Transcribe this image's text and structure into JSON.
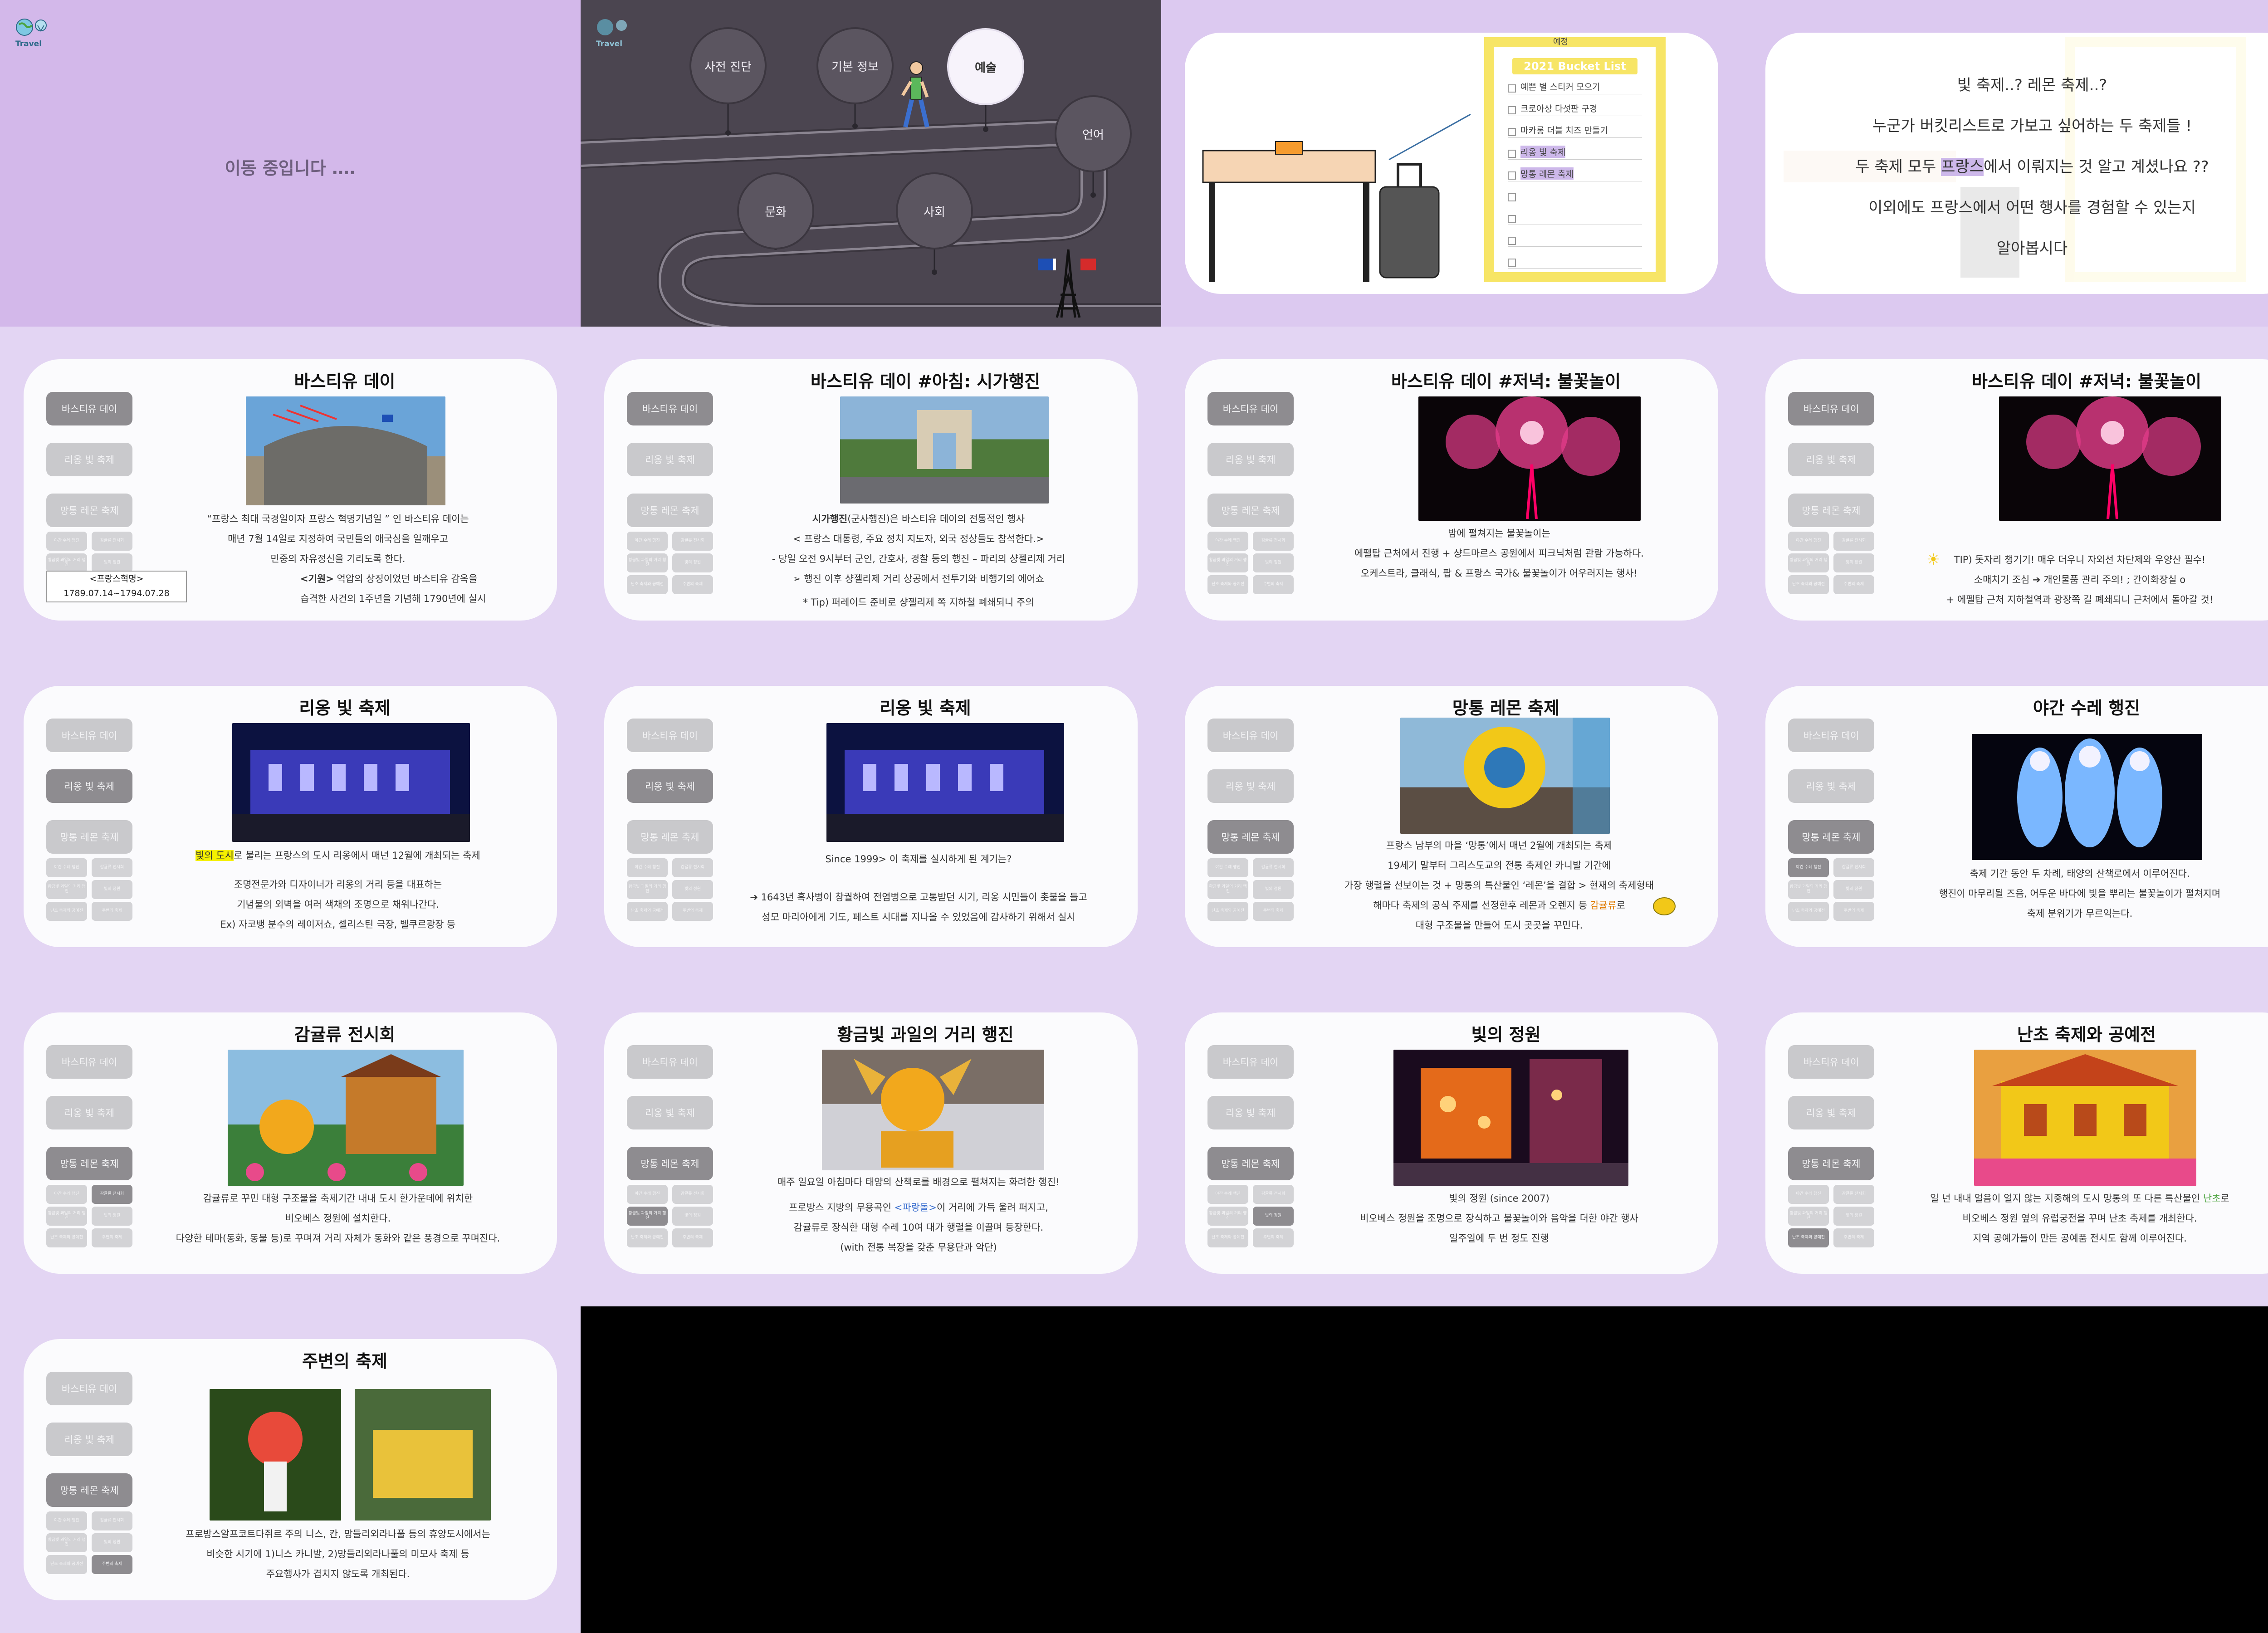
{
  "colors": {
    "lavender": "#d3b8ea",
    "map_bg": "#4b4550",
    "slide_bg": "#e3d5f3",
    "side_on": "#8e8c90",
    "side_off": "#c9c9cc"
  },
  "intro": {
    "logo_text": "Travel",
    "moving_text": "이동 중입니다 ….",
    "map_nodes": [
      "사전 진단",
      "기본 정보",
      "예술",
      "언어",
      "문화",
      "사회"
    ],
    "bucket_tag": "예정",
    "bucket_title": "2021 Bucket List",
    "bucket_items": [
      "예쁜 별 스티커 모으기",
      "크로아상 다섯판 구경",
      "마카롱 더블 치즈 만들기",
      "리옹 빛 축제",
      "망통 레몬 축제",
      "",
      "",
      "",
      ""
    ],
    "question_lines": [
      "빛 축제..? 레몬 축제..?",
      "누군가 버킷리스트로 가보고 싶어하는 두 축제들 !",
      "두 축제 모두 ",
      "프랑스",
      "에서 이뤄지는 것 알고 계셨나요 ??",
      "이외에도 프랑스에서 어떤 행사를 경험할 수 있는지",
      "알아봅시다"
    ]
  },
  "sidebar": {
    "main": [
      "바스티유 데이",
      "리옹 빛 축제",
      "망통 레몬 축제"
    ],
    "sub": [
      "야간 수레 행진",
      "감귤류 전시회",
      "황금빛 과일의 거리 행진",
      "빛의 정원",
      "난초 축제와 공예전",
      "주변의 축제"
    ]
  },
  "slides": [
    {
      "title": "바스티유 데이",
      "lines": [
        "“프랑스 최대 국경일이자 프랑스 혁명기념일 ” 인 바스티유 데이는",
        "매년 7월 14일로 지정하여 국민들의 애국심을 일깨우고",
        "민중의 자유정신을 기리도록 한다."
      ],
      "box_title": "<프랑스혁명>",
      "box_dates": "1789.07.14~1794.07.28",
      "origin_label": "<기원>",
      "origin_lines": [
        " 억압의 상징이었던 바스티유 감옥을",
        "습격한 사건의 1주년을 기념해 1790년에 실시"
      ]
    },
    {
      "title": "바스티유 데이 #아침: 시가행진",
      "lead": "시가행진",
      "lines": [
        "(군사행진)은 바스티유 데이의 전통적인 행사",
        "< 프랑스 대통령, 주요 정치 지도자, 외국 정상들도 참석한다.>",
        "- 당일 오전 9시부터 군인, 간호사, 경찰 등의 행진 – 파리의 샹젤리제 거리",
        "➢  행진 이후 샹젤리제 거리 상공에서 전투기와 비행기의 에어쇼",
        "* Tip) 퍼레이드 준비로 샹젤리제 쪽 지하철 폐쇄되니 주의"
      ]
    },
    {
      "title": "바스티유 데이 #저녁: 불꽃놀이",
      "lines": [
        "밤에 펼쳐지는 불꽃놀이는",
        "에펠탑 근처에서 진행 + 샹드마르스 공원에서 피크닉처럼 관람 가능하다.",
        "오케스트라, 클래식, 팝 & 프랑스 국가& 불꽃놀이가 어우러지는 행사!"
      ]
    },
    {
      "title": "바스티유 데이 #저녁: 불꽃놀이",
      "lines": [
        "TIP) 돗자리 챙기기! 매우 더우니 자외선 차단제와 우양산 필수!",
        "소매치기 조심 ➔ 개인물품 관리 주의! ; 간이화장실 o",
        "+ 에펠탑 근처 지하철역과 광장쪽 길 폐쇄되니 근처에서 돌아갈 것!"
      ]
    },
    {
      "title": "리옹 빛 축제",
      "hl": "빛의 도시",
      "lines": [
        "로 불리는 프랑스의 도시 리옹에서 매년 12월에 개최되는 축제",
        "조명전문가와 디자이너가 리옹의 거리 등을 대표하는",
        "기념물의 외벽을 여러 색채의 조명으로 채워나간다.",
        "Ex) 자코뱅 분수의 레이저쇼, 셀리스틴 극장, 벨쿠르광장 등"
      ]
    },
    {
      "title": "리옹 빛 축제",
      "lines": [
        "Since 1999> 이 축제를 실시하게 된 계기는?",
        "➔ 1643년 흑사병이 창궐하여 전염병으로 고통받던 시기, 리옹 시민들이 촛불을 들고",
        "성모 마리아에게 기도, 페스트 시대를 지나올 수 있었음에 감사하기 위해서 실시"
      ]
    },
    {
      "title": "망통 레몬 축제",
      "lines": [
        "프랑스 남부의 마을 ‘망통’에서 매년 2월에 개최되는 축제",
        "19세기 말부터 그리스도교의 전통 축제인 카니발 기간에",
        "가장 행렬을 선보이는 것 + 망통의 특산물인 ‘레몬’을 결합 > 현재의 축제형태",
        "해마다 축제의 공식 주제를 선정한후 레몬과 오렌지 등 ",
        "감귤류",
        "로",
        "대형 구조물을 만들어 도시 곳곳을 꾸민다."
      ]
    },
    {
      "title": "야간 수레 행진",
      "lines": [
        "축제 기간 동안 두 차례, 태양의 산책로에서 이루어진다.",
        "행진이 마무리될 즈음, 어두운 바다에 빛을 뿌리는 불꽃놀이가 펼쳐지며",
        "축제 분위기가 무르익는다."
      ]
    },
    {
      "title": "감귤류 전시회",
      "lines": [
        "감귤류로 꾸민 대형 구조물을 축제기간 내내 도시 한가운데에 위치한",
        "비오베스 정원에 설치한다.",
        "다양한 테마(동화, 동물 등)로 꾸며져 거리 자체가 동화와 같은 풍경으로 꾸며진다."
      ]
    },
    {
      "title": "황금빛 과일의 거리 행진",
      "lines": [
        "매주 일요일 아침마다 태양의 산책로를 배경으로 펼쳐지는 화려한 행진!",
        "프로방스 지방의 무용곡인 ",
        "<파랑돌>",
        "이 거리에 가득 울려 퍼지고,",
        "감귤류로 장식한 대형 수레 10여 대가 행렬을 이끌며 등장한다.",
        "(with 전통 복장을 갖춘 무용단과 악단)"
      ]
    },
    {
      "title": "빛의 정원",
      "lines": [
        "빛의 정원 (since 2007)",
        "비오베스 정원을 조명으로 장식하고 불꽃놀이와 음악을 더한 야간 행사",
        "일주일에 두 번 정도 진행"
      ]
    },
    {
      "title": "난초 축제와 공예전",
      "lines": [
        "일 년 내내 얼음이 얼지 않는 지중해의 도시 망통의 또 다른 특산물인 ",
        "난초",
        "로",
        "비오베스 정원 옆의 유럽궁전을 꾸며 난초 축제를 개최한다.",
        "지역 공예가들이 만든 공예품 전시도 함께 이루어진다."
      ]
    },
    {
      "title": "주변의 축제",
      "lines": [
        "프로방스알프코트다쥐르 주의 니스, 칸, 망들리외라나풀 등의 휴양도시에서는",
        "비슷한 시기에  1)니스 카니발,   2)망들리외라나풀의 미모사 축제 등",
        "주요행사가 겹치지 않도록 개최된다."
      ]
    }
  ]
}
